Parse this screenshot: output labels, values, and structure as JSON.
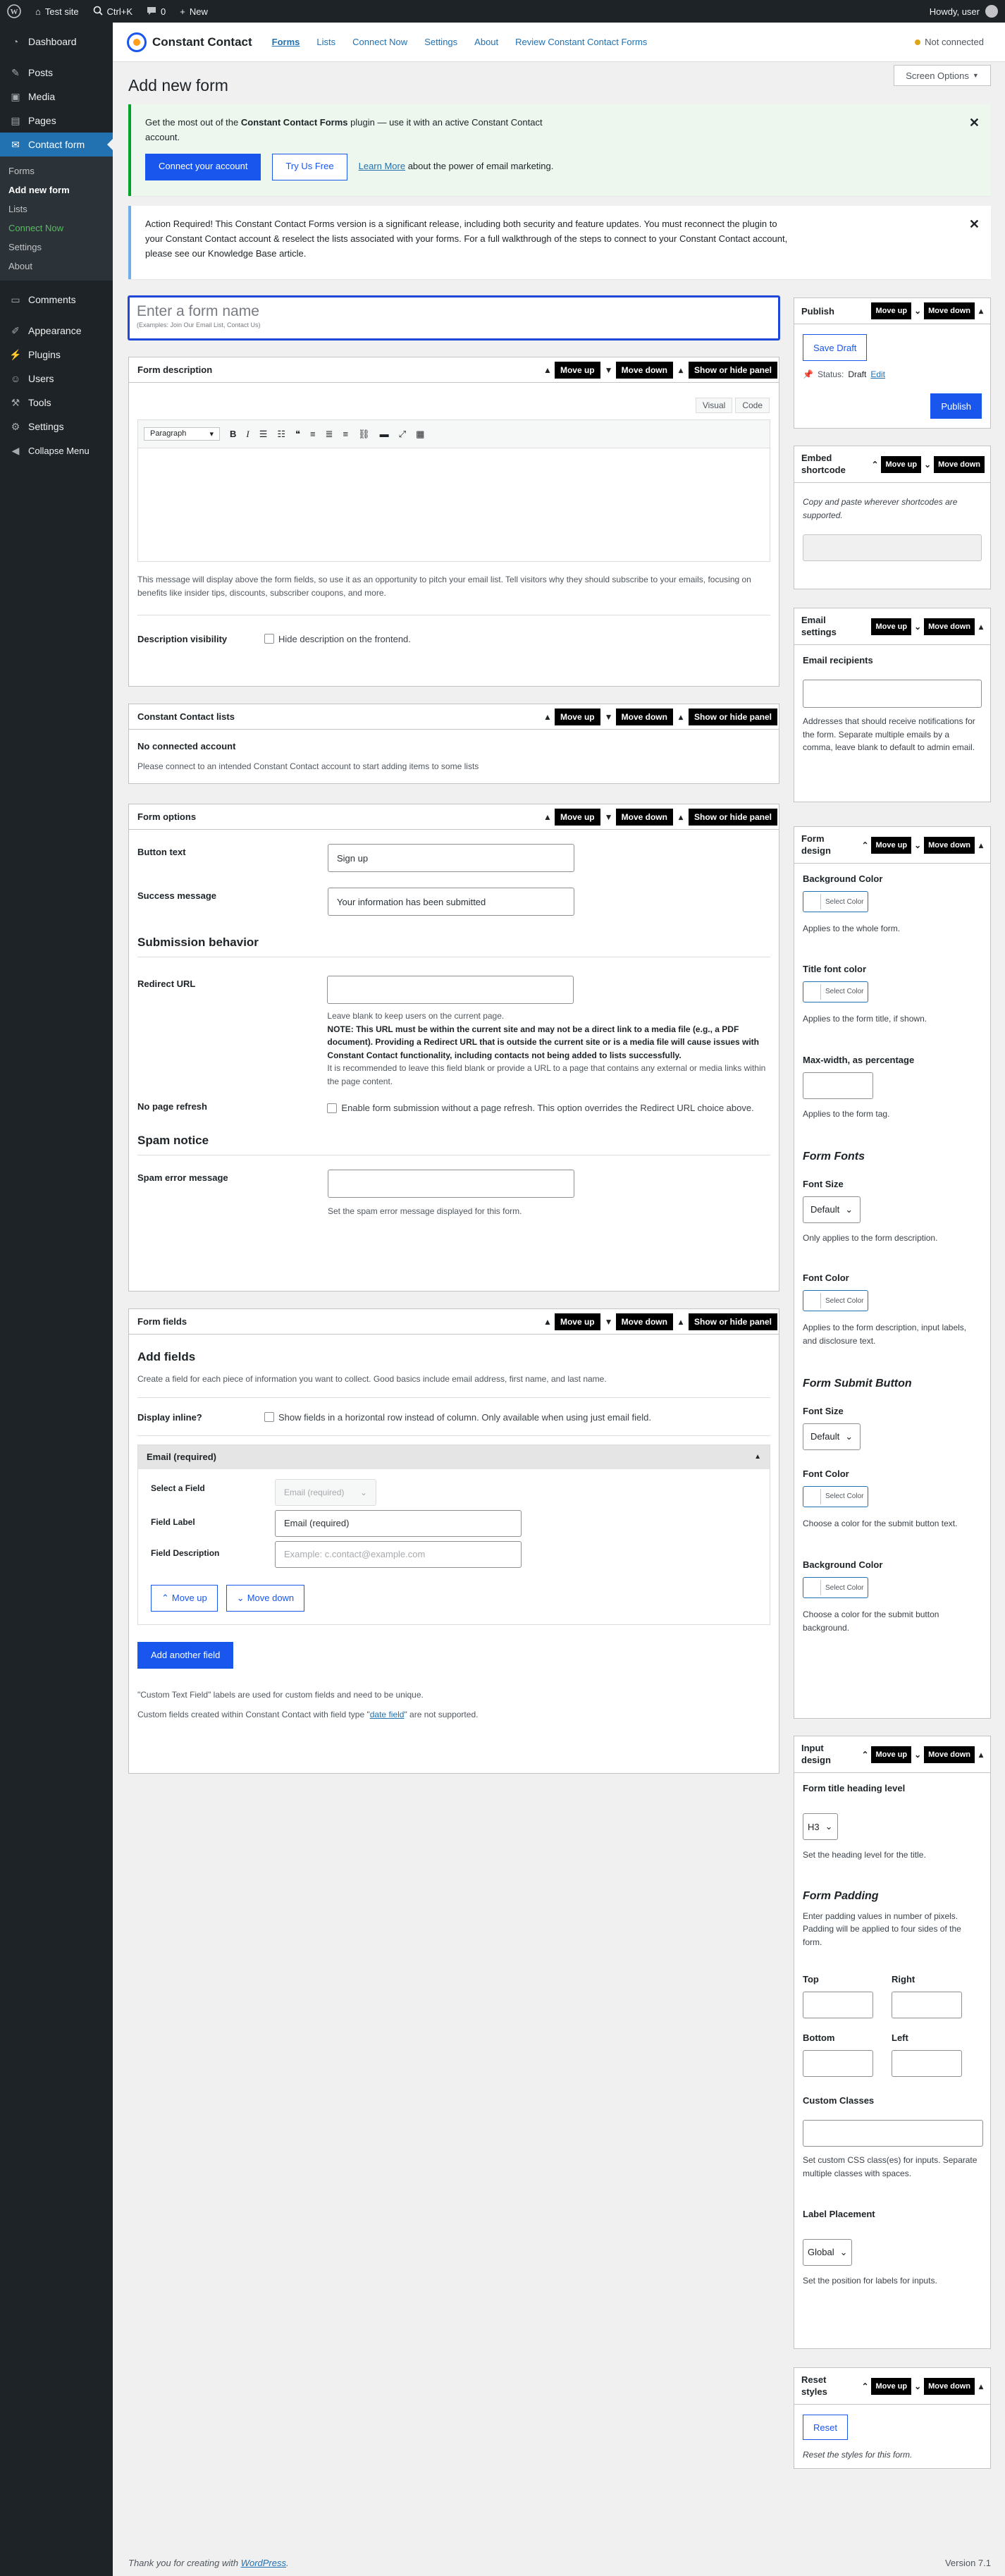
{
  "admin_bar": {
    "site_name": "Test site",
    "shortcut": "Ctrl+K",
    "comments_count": "0",
    "new_label": "New",
    "howdy": "Howdy, user"
  },
  "sidebar": {
    "items": [
      {
        "label": "Dashboard",
        "icon": "dashboard-icon"
      },
      {
        "label": "Posts",
        "icon": "pin-icon"
      },
      {
        "label": "Media",
        "icon": "media-icon"
      },
      {
        "label": "Pages",
        "icon": "page-icon"
      },
      {
        "label": "Contact form",
        "icon": "contact-form-icon"
      },
      {
        "label": "Comments",
        "icon": "comment-icon"
      },
      {
        "label": "Appearance",
        "icon": "brush-icon"
      },
      {
        "label": "Plugins",
        "icon": "plugin-icon"
      },
      {
        "label": "Users",
        "icon": "users-icon"
      },
      {
        "label": "Tools",
        "icon": "wrench-icon"
      },
      {
        "label": "Settings",
        "icon": "settings-icon"
      },
      {
        "label": "Collapse Menu",
        "icon": "collapse-icon"
      }
    ],
    "submenu": [
      "Forms",
      "Add new form",
      "Lists",
      "Connect Now",
      "Settings",
      "About"
    ]
  },
  "plugin_header": {
    "brand": "Constant Contact",
    "nav": [
      "Forms",
      "Lists",
      "Connect Now",
      "Settings",
      "About",
      "Review Constant Contact Forms"
    ],
    "status": "Not connected"
  },
  "screen_options": "Screen Options",
  "page_title": "Add new form",
  "notice_connect": {
    "text_before": "Get the most out of the ",
    "text_bold": "Constant Contact Forms",
    "text_after": " plugin — use it with an active Constant Contact account.",
    "btn_connect": "Connect your account",
    "btn_try": "Try Us Free",
    "learn_link": "Learn More",
    "learn_after": " about the power of email marketing."
  },
  "notice_action": {
    "text": "Action Required! This Constant Contact Forms version is a significant release, including both security and feature updates. You must reconnect the plugin to your Constant Contact account & reselect the lists associated with your forms. For a full walkthrough of the steps to connect to your Constant Contact account, please see our Knowledge Base article."
  },
  "form_name": {
    "placeholder": "Enter a form name",
    "example": "(Examples: Join Our Email List, Contact Us)"
  },
  "buttons": {
    "move_up": "Move up",
    "move_down": "Move down",
    "show_hide": "Show or hide panel"
  },
  "form_description": {
    "title": "Form description",
    "tab_visual": "Visual",
    "tab_code": "Code",
    "format": "Paragraph",
    "help": "This message will display above the form fields, so use it as an opportunity to pitch your email list. Tell visitors why they should subscribe to your emails, focusing on benefits like insider tips, discounts, subscriber coupons, and more.",
    "visibility_label": "Description visibility",
    "visibility_option": "Hide description on the frontend."
  },
  "cc_lists": {
    "title": "Constant Contact lists",
    "no_account": "No connected account",
    "help": "Please connect to an intended Constant Contact account to start adding items to some lists"
  },
  "form_options": {
    "title": "Form options",
    "button_text_label": "Button text",
    "button_text_value": "Sign up",
    "success_label": "Success message",
    "success_value": "Your information has been submitted",
    "submission_heading": "Submission behavior",
    "redirect_label": "Redirect URL",
    "redirect_help1": "Leave blank to keep users on the current page.",
    "redirect_note": "NOTE: This URL must be within the current site and may not be a direct link to a media file (e.g., a PDF document). Providing a Redirect URL that is outside the current site or is a media file will cause issues with Constant Contact functionality, including contacts not being added to lists successfully.",
    "redirect_help2": "It is recommended to leave this field blank or provide a URL to a page that contains any external or media links within the page content.",
    "no_refresh_label": "No page refresh",
    "no_refresh_option": "Enable form submission without a page refresh. This option overrides the Redirect URL choice above.",
    "spam_heading": "Spam notice",
    "spam_label": "Spam error message",
    "spam_help": "Set the spam error message displayed for this form."
  },
  "form_fields": {
    "title": "Form fields",
    "add_heading": "Add fields",
    "add_help": "Create a field for each piece of information you want to collect. Good basics include email address, first name, and last name.",
    "inline_label": "Display inline?",
    "inline_option": "Show fields in a horizontal row instead of column. Only available when using just email field.",
    "group_title": "Email (required)",
    "select_field_label": "Select a Field",
    "select_field_value": "Email (required)",
    "field_label_label": "Field Label",
    "field_label_value": "Email (required)",
    "field_desc_label": "Field Description",
    "field_desc_placeholder": "Example: c.contact@example.com",
    "move_up": "Move up",
    "move_down": "Move down",
    "add_another": "Add another field",
    "note1": "\"Custom Text Field\" labels are used for custom fields and need to be unique.",
    "note2_before": "Custom fields created within Constant Contact with field type \"",
    "note2_link": "date field",
    "note2_after": "\" are not supported."
  },
  "publish": {
    "title": "Publish",
    "save_draft": "Save Draft",
    "status_label": "Status:",
    "status_value": "Draft",
    "edit": "Edit",
    "publish_btn": "Publish"
  },
  "embed": {
    "title": "Embed shortcode",
    "help": "Copy and paste wherever shortcodes are supported."
  },
  "email_settings": {
    "title": "Email settings",
    "recipients_label": "Email recipients",
    "help": "Addresses that should receive notifications for the form. Separate multiple emails by a comma, leave blank to default to admin email."
  },
  "form_design": {
    "title": "Form design",
    "bg_label": "Background Color",
    "select_color": "Select Color",
    "bg_help": "Applies to the whole form.",
    "title_font_label": "Title font color",
    "title_font_help": "Applies to the form title, if shown.",
    "maxwidth_label": "Max-width, as percentage",
    "maxwidth_help": "Applies to the form tag.",
    "fonts_heading": "Form Fonts",
    "font_size_label": "Font Size",
    "font_size_value": "Default",
    "font_size_help": "Only applies to the form description.",
    "font_color_label": "Font Color",
    "font_color_help": "Applies to the form description, input labels, and disclosure text.",
    "submit_heading": "Form Submit Button",
    "submit_font_size_label": "Font Size",
    "submit_font_size_value": "Default",
    "submit_font_color_label": "Font Color",
    "submit_font_color_help": "Choose a color for the submit button text.",
    "submit_bg_label": "Background Color",
    "submit_bg_help": "Choose a color for the submit button background."
  },
  "input_design": {
    "title": "Input design",
    "heading_level_label": "Form title heading level",
    "heading_level_value": "H3",
    "heading_level_help": "Set the heading level for the title.",
    "padding_heading": "Form Padding",
    "padding_help": "Enter padding values in number of pixels. Padding will be applied to four sides of the form.",
    "top": "Top",
    "right": "Right",
    "bottom": "Bottom",
    "left": "Left",
    "classes_label": "Custom Classes",
    "classes_help": "Set custom CSS class(es) for inputs. Separate multiple classes with spaces.",
    "label_placement_label": "Label Placement",
    "label_placement_value": "Global",
    "label_placement_help": "Set the position for labels for inputs."
  },
  "reset_styles": {
    "title": "Reset styles",
    "reset_btn": "Reset",
    "help": "Reset the styles for this form."
  },
  "footer": {
    "text_before": "Thank you for creating with ",
    "link": "WordPress",
    "text_after": ".",
    "version": "Version 7.1"
  },
  "colors": {
    "accent": "#1856ed",
    "admin_dark": "#1d2327",
    "wp_blue": "#2271b1",
    "status_dot": "#dba617"
  }
}
